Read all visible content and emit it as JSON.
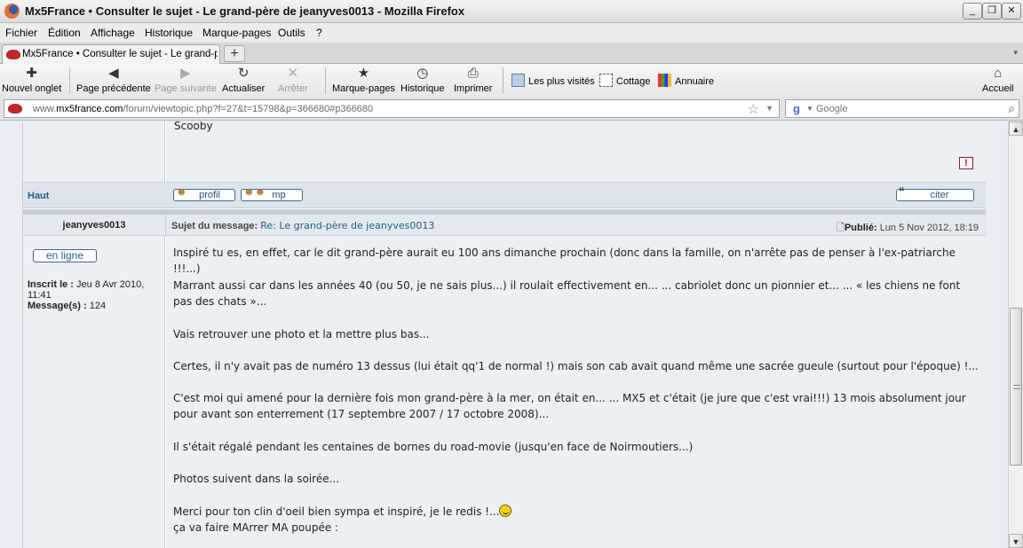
{
  "window": {
    "title": "Mx5France • Consulter le sujet - Le grand-père de jeanyves0013 - Mozilla Firefox",
    "minimize": "_",
    "maximize": "❐",
    "close": "✕"
  },
  "menu": [
    "Fichier",
    "Édition",
    "Affichage",
    "Historique",
    "Marque-pages",
    "Outils",
    "?"
  ],
  "tab": {
    "label": "Mx5France • Consulter le sujet - Le grand-p...",
    "new_tab": "+"
  },
  "toolbar": {
    "new_tab": "Nouvel onglet",
    "back": "Page précédente",
    "forward": "Page suivante",
    "reload": "Actualiser",
    "stop": "Arrêter",
    "bookmarks": "Marque-pages",
    "history": "Historique",
    "print": "Imprimer",
    "home": "Accueil"
  },
  "bookmarks_bar": [
    "Les plus visités",
    "Cottage",
    "Annuaire"
  ],
  "address": {
    "prefix": "www.",
    "domain": "mx5france.com",
    "path": "/forum/viewtopic.php?f=27&t=15798&p=366680#p366680"
  },
  "search": {
    "placeholder": "Google"
  },
  "previous_post": {
    "signature": "Scooby",
    "report": "!",
    "top_link": "Haut",
    "profile_button": "profil",
    "pm_button": "mp",
    "quote_button": "citer"
  },
  "post": {
    "author": "jeanyves0013",
    "subject_label": "Sujet du message:",
    "subject": "Re: Le grand-père de jeanyves0013",
    "published_label": "Publié:",
    "published": "Lun 5 Nov 2012, 18:19",
    "online": "en ligne",
    "joined_label": "Inscrit le :",
    "joined": "Jeu 8 Avr 2010, 11:41",
    "messages_label": "Message(s) :",
    "messages": "124",
    "paragraphs": [
      "Inspiré tu es, en effet, car le dit grand-père aurait eu 100 ans dimanche prochain (donc dans la famille, on n'arrête pas de penser à l'ex-patriarche !!!...)",
      "Marrant aussi car dans les années 40 (ou 50, je ne sais plus...) il roulait effectivement en... ... cabriolet donc un pionnier et... ... « les chiens ne font pas des chats »...",
      "Vais retrouver une photo et la mettre plus bas...",
      "Certes,   il n'y avait pas de numéro 13 dessus (lui était qq'1 de normal !) mais son cab avait quand même une sacrée gueule  (surtout pour l'époque) !...",
      "C'est moi qui amené pour la dernière fois mon grand-père à la mer, on était en... ... MX5 et c'était (je jure que c'est vrai!!!) 13 mois absolument jour pour avant son enterrement (17 septembre 2007 / 17 octobre 2008)...",
      "Il s'était régalé pendant les centaines de bornes du road-movie (jusqu'en face de Noirmoutiers...)",
      "Photos suivent dans la soirée...",
      "Merci pour ton clin d'oeil bien sympa et inspiré, je le redis !...",
      "ça va faire MArrer MA poupée :"
    ]
  }
}
